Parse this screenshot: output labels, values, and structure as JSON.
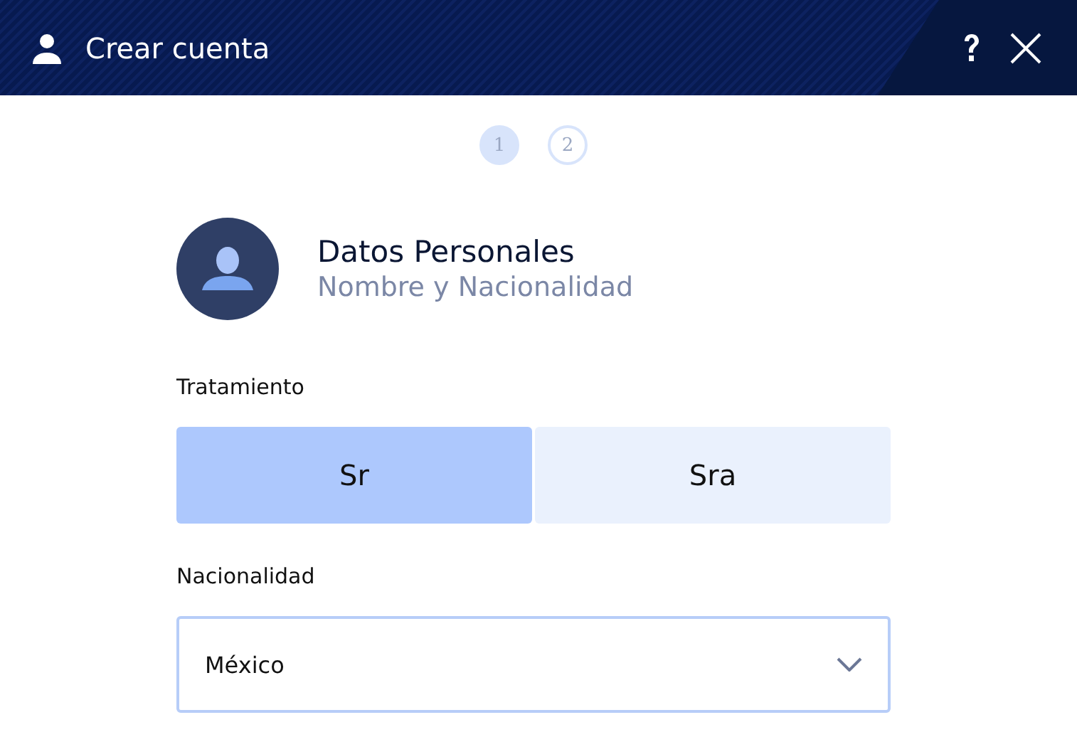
{
  "window": {
    "title": "Crear cuenta"
  },
  "steps": [
    {
      "label": "1",
      "selected": true
    },
    {
      "label": "2",
      "selected": false
    }
  ],
  "section": {
    "title": "Datos Personales",
    "subtitle": "Nombre y Nacionalidad"
  },
  "treatment": {
    "label": "Tratamiento",
    "options": [
      {
        "label": "Sr",
        "selected": true
      },
      {
        "label": "Sra",
        "selected": false
      }
    ]
  },
  "nationality": {
    "label": "Nacionalidad",
    "value": "México"
  }
}
